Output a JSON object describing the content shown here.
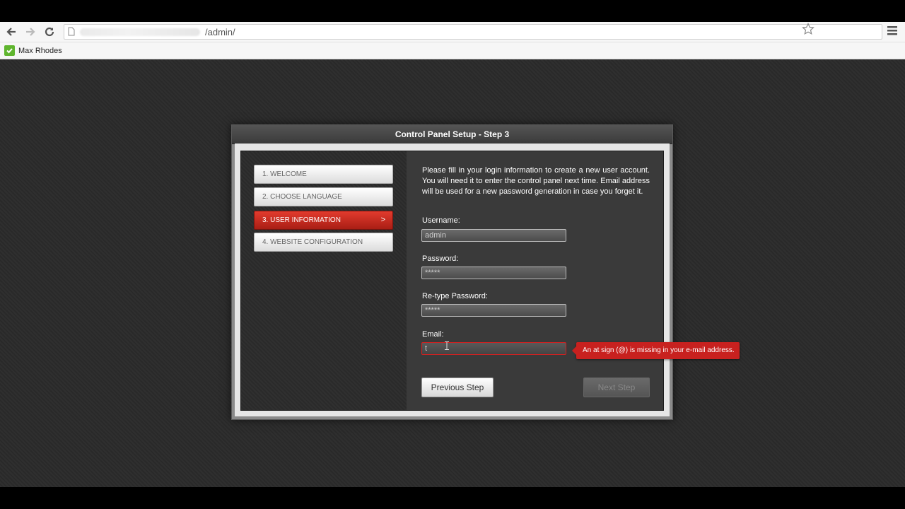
{
  "browser": {
    "url_path": "/admin/",
    "bookmark_label": "Max Rhodes"
  },
  "panel": {
    "title": "Control Panel Setup - Step 3"
  },
  "steps": [
    {
      "label": "1. WELCOME"
    },
    {
      "label": "2. CHOOSE LANGUAGE"
    },
    {
      "label": "3. USER INFORMATION",
      "chevron": ">"
    },
    {
      "label": "4. WEBSITE CONFIGURATION"
    }
  ],
  "form": {
    "intro": "Please fill in your login information to create a new user account. You will need it to enter the control panel next time. Email address will be used for a new password generation in case you forget it.",
    "username_label": "Username:",
    "username_value": "admin",
    "password_label": "Password:",
    "password_value": "*****",
    "retype_label": "Re-type Password:",
    "retype_value": "*****",
    "email_label": "Email:",
    "email_value": "t",
    "error_message": "An at sign (@) is missing in your e-mail address.",
    "prev_label": "Previous Step",
    "next_label": "Next Step"
  },
  "colors": {
    "accent": "#c8211f",
    "page_bg": "#2b2b2b"
  }
}
